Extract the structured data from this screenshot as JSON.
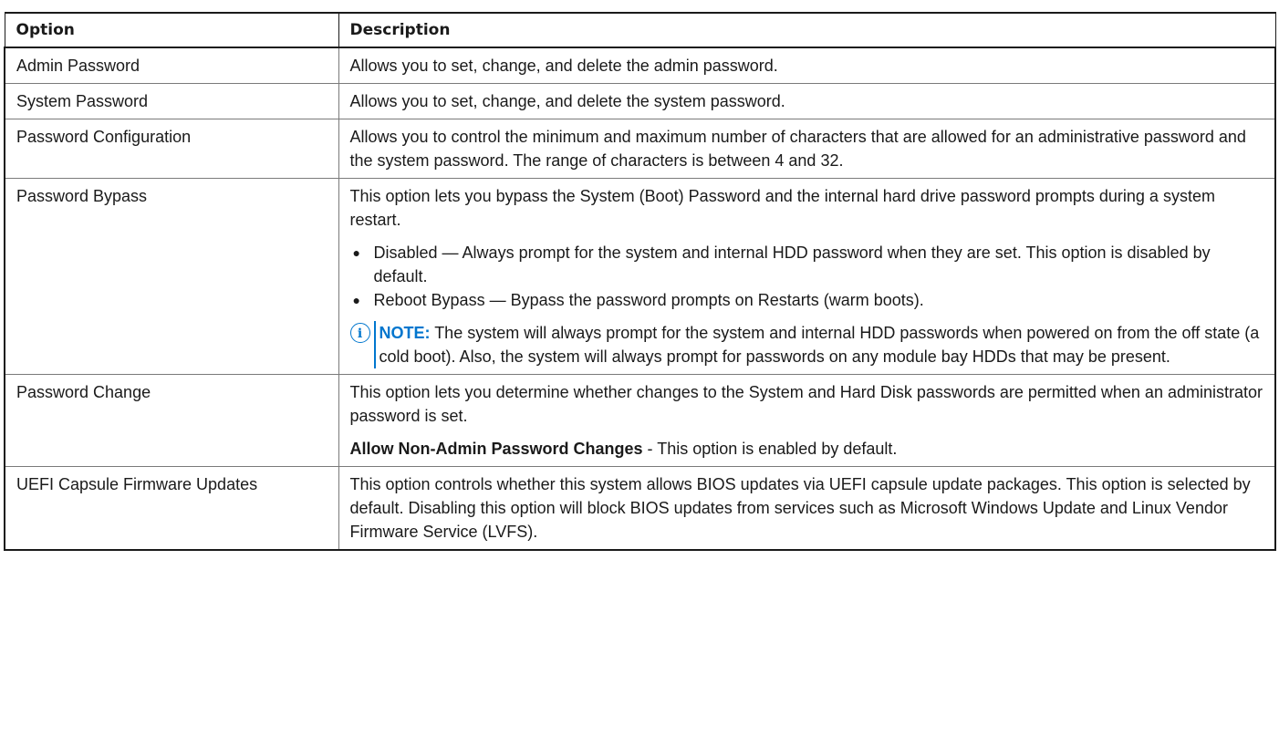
{
  "table": {
    "headers": {
      "option": "Option",
      "description": "Description"
    },
    "rows": [
      {
        "option": "Admin Password",
        "description": "Allows you to set, change, and delete the admin password."
      },
      {
        "option": "System Password",
        "description": "Allows you to set, change, and delete the system password."
      },
      {
        "option": "Password Configuration",
        "description": "Allows you to control the minimum and maximum number of characters that are allowed for an administrative password and the system password. The range of characters is between 4 and 32."
      },
      {
        "option": "Password Bypass",
        "description": "This option lets you bypass the System (Boot) Password and the internal hard drive password prompts during a system restart.",
        "bullets": [
          "Disabled — Always prompt for the system and internal HDD password when they are set. This option is disabled by default.",
          "Reboot Bypass — Bypass the password prompts on Restarts (warm boots)."
        ],
        "note": {
          "icon": "info-icon",
          "label": "NOTE:",
          "text": "The system will always prompt for the system and internal HDD passwords when powered on from the off state (a cold boot). Also, the system will always prompt for passwords on any module bay HDDs that may be present."
        }
      },
      {
        "option": "Password Change",
        "description": "This option lets you determine whether changes to the System and Hard Disk passwords are permitted when an administrator password is set.",
        "setting_bold": "Allow Non-Admin Password Changes",
        "setting_rest": " - This option is enabled by default."
      },
      {
        "option": "UEFI Capsule Firmware Updates",
        "description": "This option controls whether this system allows BIOS updates via UEFI capsule update packages. This option is selected by default. Disabling this option will block BIOS updates from services such as Microsoft Windows Update and Linux Vendor Firmware Service (LVFS)."
      }
    ]
  },
  "colors": {
    "accent": "#0076ce",
    "text": "#1a1a1a",
    "border": "#7a7a7a"
  }
}
